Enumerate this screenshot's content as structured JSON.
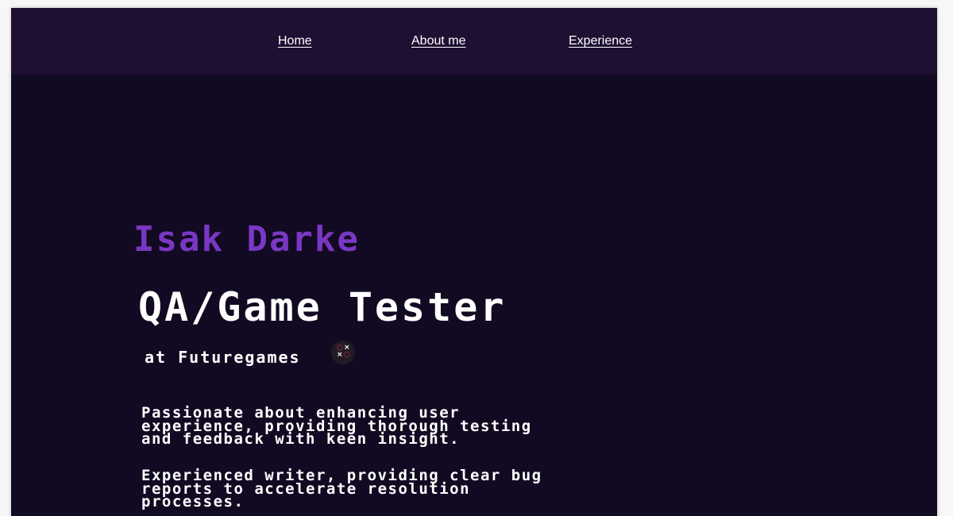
{
  "nav": {
    "items": [
      {
        "label": "Home"
      },
      {
        "label": "About me"
      },
      {
        "label": "Experience"
      }
    ]
  },
  "hero": {
    "name": "Isak Darke",
    "role": "QA/Game Tester",
    "company": "at Futuregames",
    "company_logo_icon": "futuregames-tic-tac-toe-logo",
    "bio": [
      "Passionate about enhancing user\nexperience, providing thorough testing\nand feedback with keen insight.",
      "Experienced writer, providing clear bug\nreports to accelerate resolution\nprocesses."
    ]
  },
  "colors": {
    "page_bg": "#120a22",
    "nav_bg": "#1e0f33",
    "accent_purple": "#7a37c4",
    "text": "#ffffff",
    "logo_red": "#e0343c"
  }
}
